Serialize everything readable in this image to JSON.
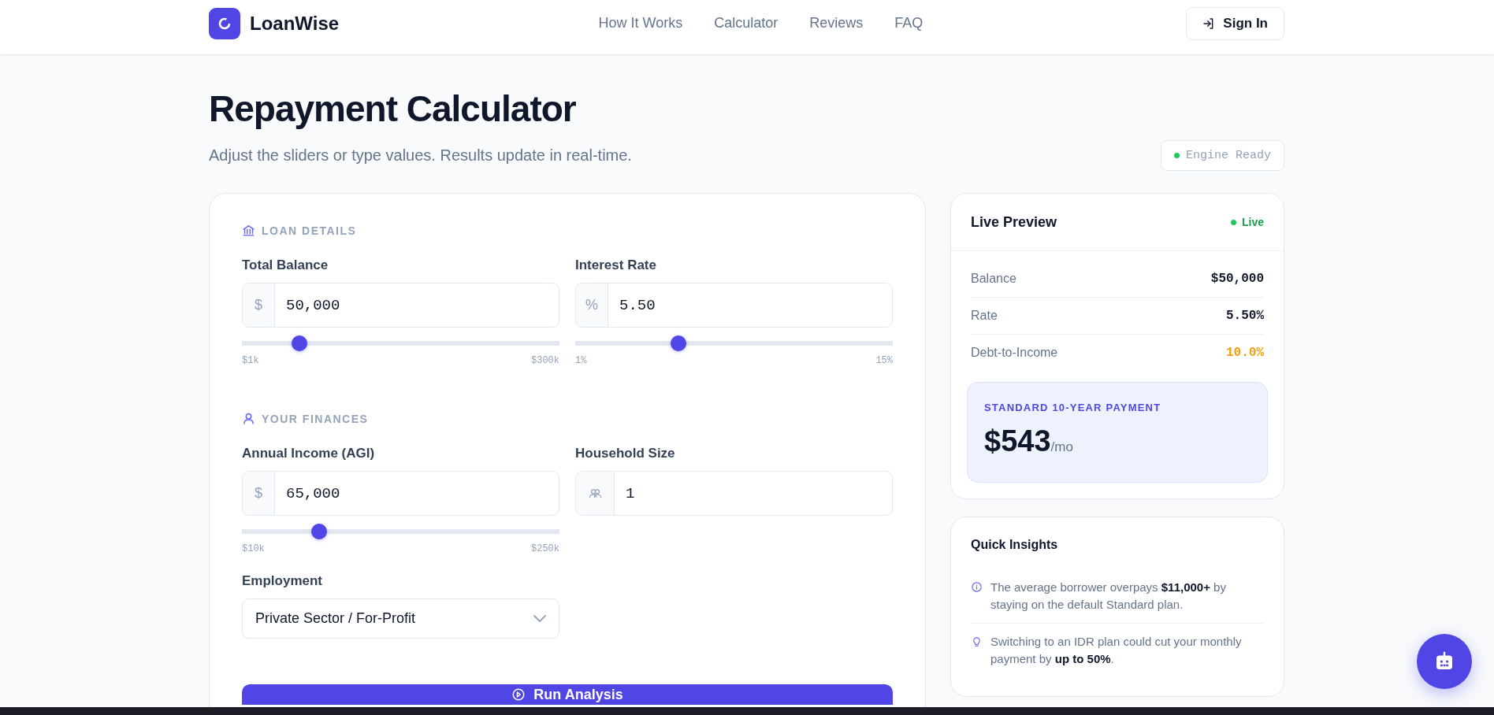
{
  "header": {
    "brand": "LoanWise",
    "nav": [
      {
        "label": "How It Works"
      },
      {
        "label": "Calculator"
      },
      {
        "label": "Reviews"
      },
      {
        "label": "FAQ"
      }
    ],
    "sign_in": "Sign In"
  },
  "page": {
    "title": "Repayment Calculator",
    "subtitle": "Adjust the sliders or type values. Results update in real-time.",
    "status": {
      "label": "Engine Ready",
      "color": "#22c55e"
    }
  },
  "form": {
    "sections": [
      {
        "title": "LOAN DETAILS",
        "fields": [
          {
            "kind": "slider",
            "label": "Total Balance",
            "prefix": "$",
            "value": "50,000",
            "level": 0.18,
            "min_label": "$1k",
            "max_label": "$300k"
          },
          {
            "kind": "slider",
            "label": "Interest Rate",
            "prefix": "%",
            "value": "5.50",
            "level": 0.326,
            "min_label": "1%",
            "max_label": "15%"
          }
        ]
      },
      {
        "title": "YOUR FINANCES",
        "fields": [
          {
            "kind": "slider",
            "label": "Annual Income (AGI)",
            "prefix": "$",
            "value": "65,000",
            "level": 0.243,
            "min_label": "$10k",
            "max_label": "$250k"
          },
          {
            "kind": "people",
            "label": "Household Size",
            "value": "1"
          },
          {
            "kind": "select",
            "label": "Employment",
            "value": "Private Sector / For-Profit"
          }
        ]
      }
    ],
    "run_button": "Run Analysis"
  },
  "preview": {
    "title": "Live Preview",
    "badge": {
      "label": "Live",
      "color": "#22c55e"
    },
    "rows": [
      {
        "label": "Balance",
        "value": "$50,000",
        "color": "#0f172a"
      },
      {
        "label": "Rate",
        "value": "5.50%",
        "color": "#0f172a"
      },
      {
        "label": "Debt-to-Income",
        "value": "10.0%",
        "color": "#f59e0b"
      }
    ],
    "payment": {
      "label": "STANDARD 10-YEAR PAYMENT",
      "amount": "$543",
      "unit": "/mo"
    }
  },
  "insights": {
    "title": "Quick Insights",
    "items": [
      {
        "text": "The average borrower overpays **$11,000+** by staying on the default Standard plan."
      },
      {
        "text": "Switching to an IDR plan could cut your monthly payment by **up to 50%**."
      }
    ]
  }
}
